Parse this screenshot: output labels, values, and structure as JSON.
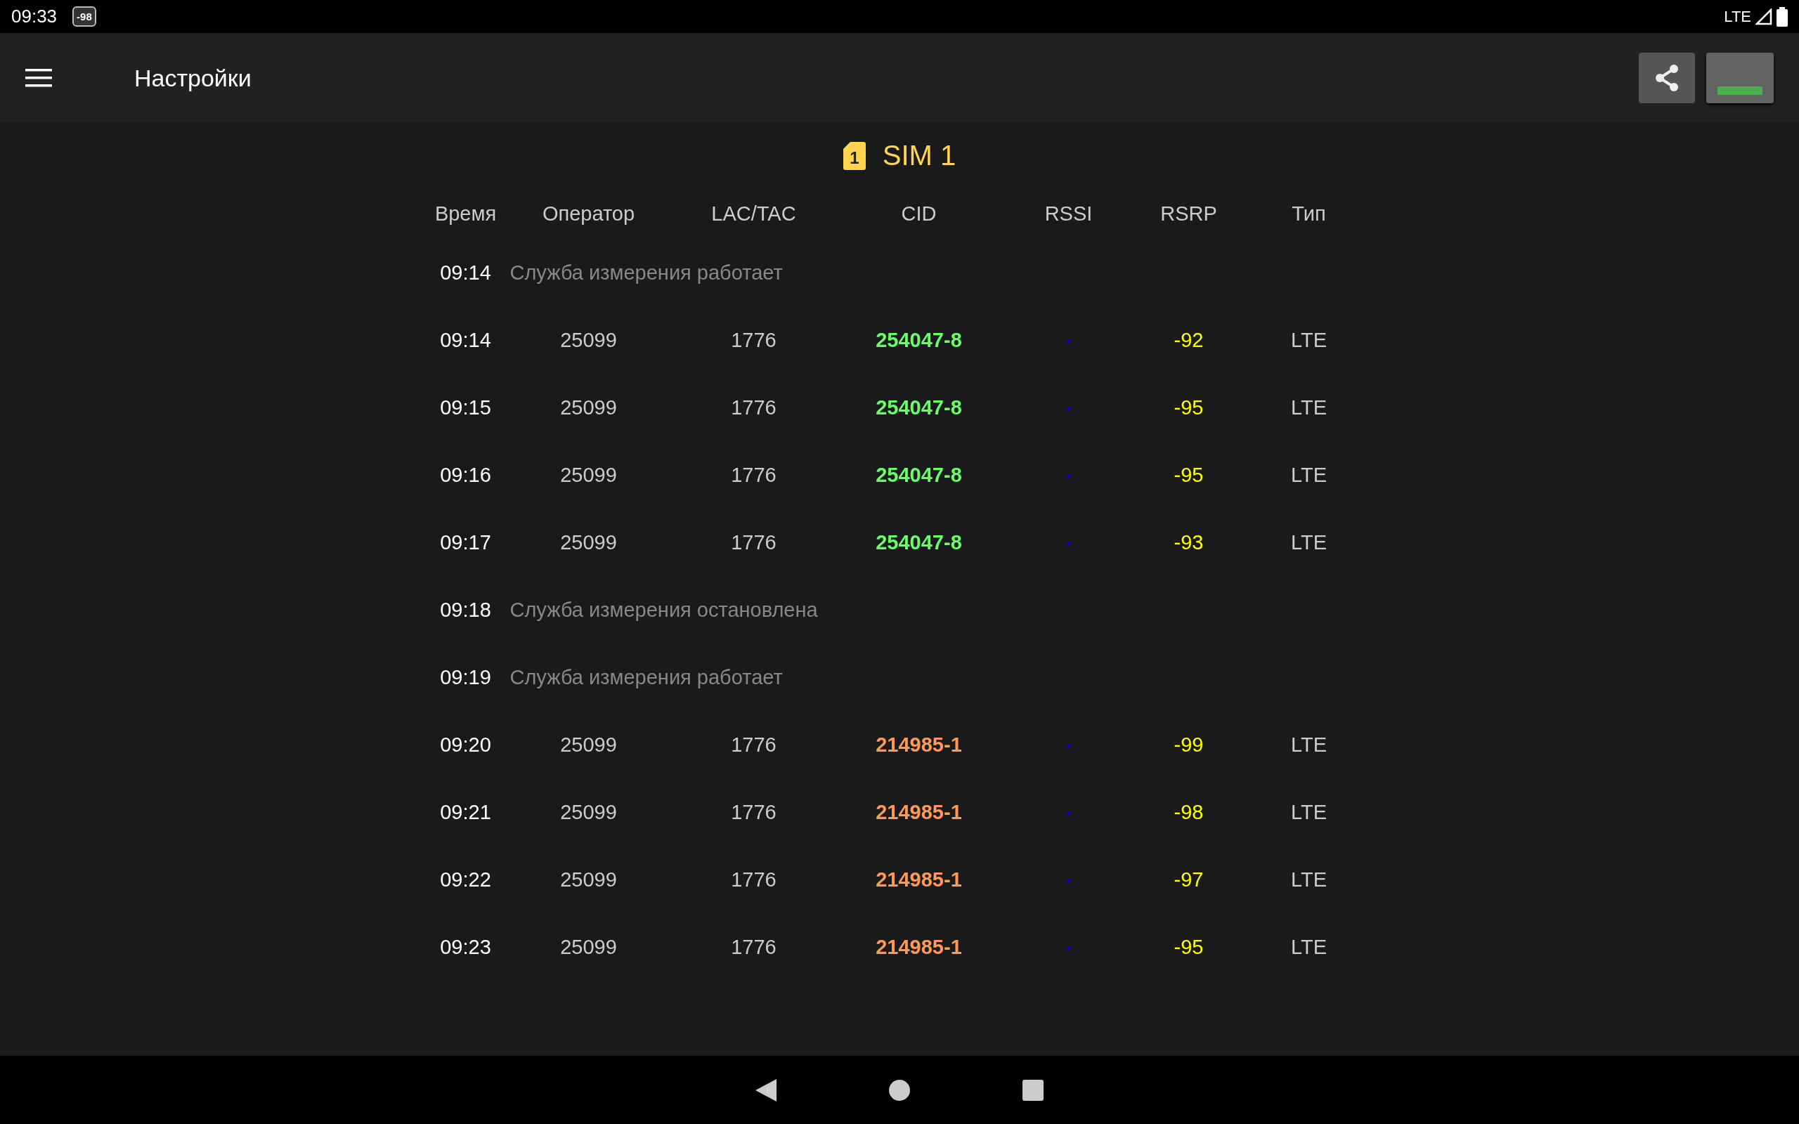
{
  "status_bar": {
    "time": "09:33",
    "badge": "-98",
    "network": "LTE"
  },
  "toolbar": {
    "title": "Настройки"
  },
  "sim": {
    "label": "SIM 1",
    "number": "1"
  },
  "table": {
    "columns": [
      "Время",
      "Оператор",
      "LAC/TAC",
      "CID",
      "RSSI",
      "RSRP",
      "Тип"
    ],
    "rows": [
      {
        "kind": "event",
        "time": "09:14",
        "message": "Служба измерения работает"
      },
      {
        "kind": "measurement",
        "time": "09:14",
        "operator": "25099",
        "lac": "1776",
        "cid": "254047-8",
        "color": "#66ff66",
        "rssi": "-",
        "rsrp": "-92",
        "type": "LTE"
      },
      {
        "kind": "measurement",
        "time": "09:15",
        "operator": "25099",
        "lac": "1776",
        "cid": "254047-8",
        "color": "#66ff66",
        "rssi": "-",
        "rsrp": "-95",
        "type": "LTE"
      },
      {
        "kind": "measurement",
        "time": "09:16",
        "operator": "25099",
        "lac": "1776",
        "cid": "254047-8",
        "color": "#66ff66",
        "rssi": "-",
        "rsrp": "-95",
        "type": "LTE"
      },
      {
        "kind": "measurement",
        "time": "09:17",
        "operator": "25099",
        "lac": "1776",
        "cid": "254047-8",
        "color": "#66ff66",
        "rssi": "-",
        "rsrp": "-93",
        "type": "LTE"
      },
      {
        "kind": "event",
        "time": "09:18",
        "message": "Служба измерения остановлена"
      },
      {
        "kind": "event",
        "time": "09:19",
        "message": "Служба измерения работает"
      },
      {
        "kind": "measurement",
        "time": "09:20",
        "operator": "25099",
        "lac": "1776",
        "cid": "214985-1",
        "color": "#ff9955",
        "rssi": "-",
        "rsrp": "-99",
        "type": "LTE"
      },
      {
        "kind": "measurement",
        "time": "09:21",
        "operator": "25099",
        "lac": "1776",
        "cid": "214985-1",
        "color": "#ff9955",
        "rssi": "-",
        "rsrp": "-98",
        "type": "LTE"
      },
      {
        "kind": "measurement",
        "time": "09:22",
        "operator": "25099",
        "lac": "1776",
        "cid": "214985-1",
        "color": "#ff9955",
        "rssi": "-",
        "rsrp": "-97",
        "type": "LTE"
      },
      {
        "kind": "measurement",
        "time": "09:23",
        "operator": "25099",
        "lac": "1776",
        "cid": "214985-1",
        "color": "#ff9955",
        "rssi": "-",
        "rsrp": "-95",
        "type": "LTE"
      }
    ]
  }
}
